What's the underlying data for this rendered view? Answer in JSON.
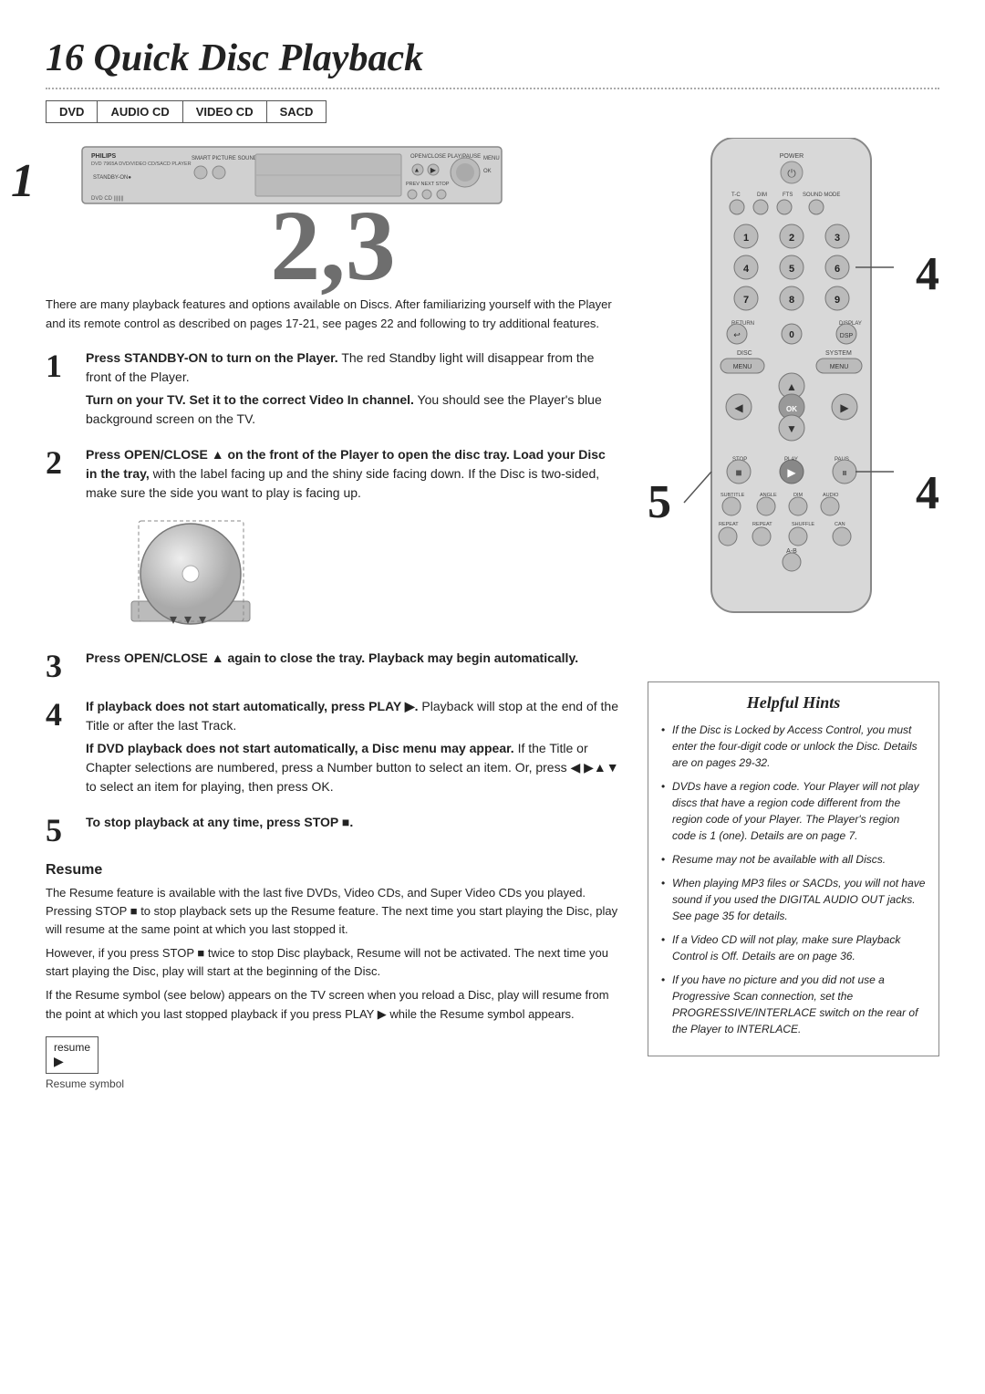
{
  "page": {
    "title": "16  Quick Disc Playback",
    "disc_types": [
      "DVD",
      "AUDIO CD",
      "VIDEO CD",
      "SACD"
    ]
  },
  "intro": {
    "text": "There are many playback features and options available on Discs. After familiarizing yourself with the Player and its remote control as described on pages 17-21, see pages 22 and following to try additional features."
  },
  "steps": [
    {
      "num": "1",
      "main": "Press STANDBY-ON to turn on the Player.",
      "main_suffix": " The red Standby light will disappear from the front of the Player.",
      "sub": "Turn on your TV. Set it to the correct Video In channel.",
      "sub_suffix": " You should see the Player's blue background screen on the TV."
    },
    {
      "num": "2",
      "main": "Press OPEN/CLOSE ▲ on the front of the Player to open the disc tray. Load your Disc in the tray,",
      "main_suffix": " with the label facing up and the shiny side facing down. If the Disc is two-sided, make sure the side you want to play is facing up."
    },
    {
      "num": "3",
      "main": "Press OPEN/CLOSE ▲ again to close the tray. Playback may begin automatically."
    },
    {
      "num": "4",
      "main": "If playback does not start automatically, press PLAY ▶.",
      "main_suffix": " Playback will stop at the end of the Title or after the last Track.",
      "sub": "If DVD playback does not start automatically, a Disc menu may appear.",
      "sub_suffix": " If the Title or Chapter selections are numbered, press a Number button to select an item. Or, press ◀ ▶▲▼ to select an item for playing, then press OK."
    },
    {
      "num": "5",
      "main": "To stop playback at any time, press STOP ■."
    }
  ],
  "resume": {
    "title": "Resume",
    "paragraphs": [
      "The Resume feature is available with the last five DVDs, Video CDs, and Super Video CDs you played. Pressing STOP ■ to stop playback sets up the Resume feature. The next time you start playing the Disc, play will resume at the same point at which you last stopped it.",
      "However, if you press STOP ■ twice to stop Disc playback, Resume will not be activated. The next time you start playing the Disc, play will start at the beginning of the Disc.",
      "If the Resume symbol (see below) appears on the TV screen when you reload a Disc, play will resume from the point at which you last stopped playback if you press PLAY ▶ while the Resume symbol appears."
    ],
    "symbol_label": "resume",
    "symbol_caption": "Resume symbol"
  },
  "helpful_hints": {
    "title": "Helpful Hints",
    "items": [
      "If the Disc is Locked by Access Control, you must enter the four-digit code or unlock the Disc. Details are on pages 29-32.",
      "DVDs have a region code. Your Player will not play discs that have a region code different from the region code of your Player. The Player's region code is 1 (one). Details are on page 7.",
      "Resume may not be available with all Discs.",
      "When playing MP3 files or SACDs, you will not have sound if you used the DIGITAL AUDIO OUT jacks. See page 35 for details.",
      "If a Video CD will not play, make sure Playback Control is Off. Details are on page 36.",
      "If you have no picture and you did not use a Progressive Scan connection, set the PROGRESSIVE/INTERLACE switch on the rear of the Player to INTERLACE."
    ]
  },
  "remote": {
    "label": "POWER",
    "rows": [
      [
        "T-C",
        "DIM",
        "FTS",
        "SOUND MODE"
      ],
      [
        "1",
        "2",
        "3"
      ],
      [
        "4",
        "5",
        "6"
      ],
      [
        "7",
        "8",
        "9"
      ],
      [
        "RETURN",
        "0",
        "DISPLAY"
      ],
      [
        "DISC",
        "SYSTEM"
      ],
      [
        "STOP",
        "PLAY",
        "PAUS"
      ],
      [
        "SUBTITLE",
        "ANGLE",
        "DIM",
        "AUDIO"
      ],
      [
        "REPEAT",
        "REPEAT",
        "SHUFFLE",
        "CAN"
      ],
      [
        "A-B"
      ]
    ]
  },
  "big_overlay_number": "2,3",
  "callouts": {
    "num4a": "4",
    "num4b": "4",
    "num5": "5"
  }
}
